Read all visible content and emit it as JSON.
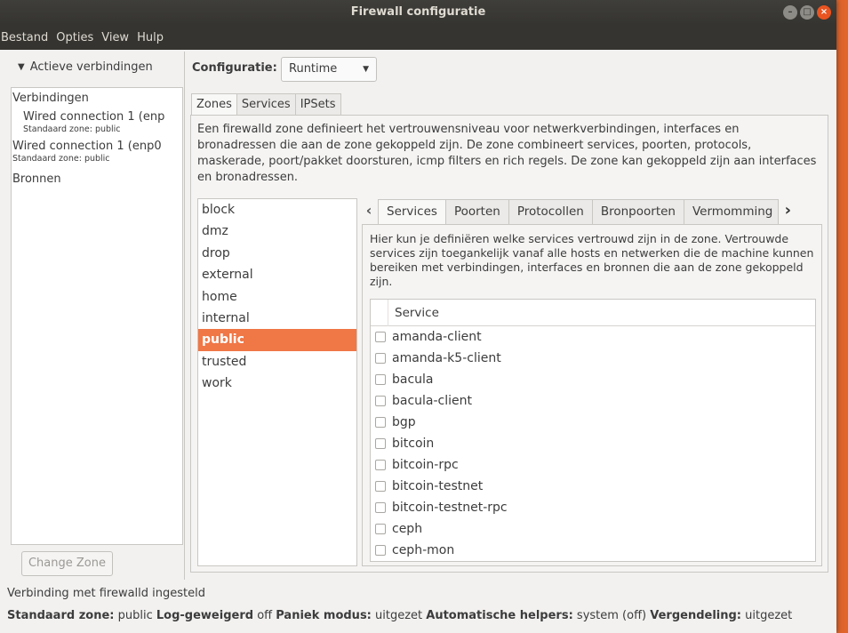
{
  "window": {
    "title": "Firewall configuratie"
  },
  "menu": [
    "Bestand",
    "Opties",
    "View",
    "Hulp"
  ],
  "sidebar": {
    "expander_label": "Actieve verbindingen",
    "tree": {
      "group_connections": "Verbindingen",
      "connections": [
        {
          "name": "Wired connection 1 (enp",
          "zone": "Standaard zone: public"
        },
        {
          "name": "Wired connection 1 (enp0",
          "zone": "Standaard zone: public"
        }
      ],
      "group_sources": "Bronnen"
    },
    "change_zone_label": "Change Zone"
  },
  "config": {
    "label": "Configuratie:",
    "value": "Runtime"
  },
  "tabs": [
    "Zones",
    "Services",
    "IPSets"
  ],
  "active_tab": "Zones",
  "zone_description": "Een firewalld zone definieert het vertrouwensniveau voor netwerkverbindingen, interfaces en bronadressen die aan de zone gekoppeld zijn. De zone combineert services, poorten, protocols, maskerade, poort/pakket doorsturen, icmp filters en rich regels. De zone kan gekoppeld zijn aan interfaces en bronadressen.",
  "zones": [
    "block",
    "dmz",
    "drop",
    "external",
    "home",
    "internal",
    "public",
    "trusted",
    "work"
  ],
  "selected_zone": "public",
  "subtabs": [
    "Services",
    "Poorten",
    "Protocollen",
    "Bronpoorten",
    "Vermomming"
  ],
  "active_subtab": "Services",
  "services_description": "Hier kun je definiëren welke services vertrouwd zijn in de zone. Vertrouwde services zijn toegankelijk vanaf alle hosts en netwerken die de machine kunnen bereiken met verbindingen, interfaces en bronnen die aan de zone gekoppeld zijn.",
  "services_table": {
    "header": "Service",
    "rows": [
      "amanda-client",
      "amanda-k5-client",
      "bacula",
      "bacula-client",
      "bgp",
      "bitcoin",
      "bitcoin-rpc",
      "bitcoin-testnet",
      "bitcoin-testnet-rpc",
      "ceph",
      "ceph-mon"
    ]
  },
  "status": {
    "connection": "Verbinding met firewalld ingesteld",
    "default_zone_label": "Standaard zone:",
    "default_zone_value": "public",
    "log_denied_label": "Log-geweigerd",
    "log_denied_value": "off",
    "panic_label": "Paniek modus:",
    "panic_value": "uitgezet",
    "helpers_label": "Automatische helpers:",
    "helpers_value": "system (off)",
    "lockdown_label": "Vergendeling:",
    "lockdown_value": "uitgezet"
  },
  "colors": {
    "selection": "#f07746",
    "close_button": "#e95420",
    "titlebar": "#3f3e3a"
  }
}
